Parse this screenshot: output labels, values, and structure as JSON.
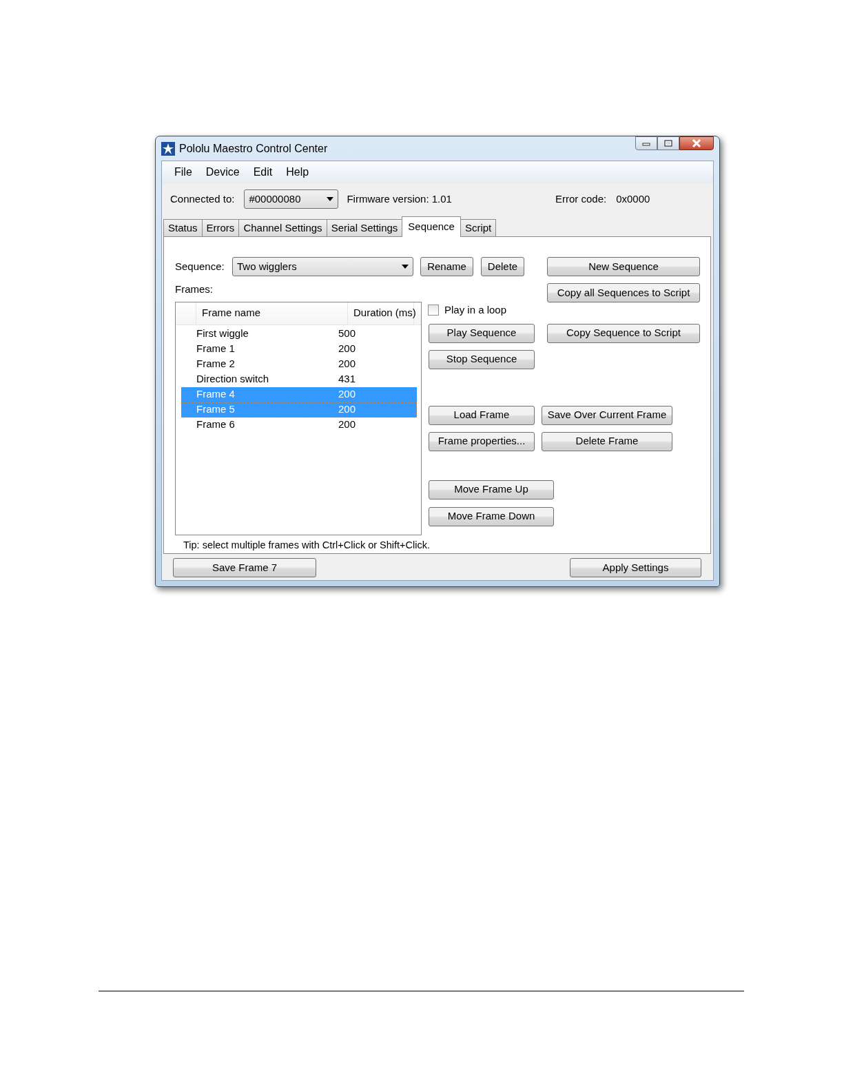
{
  "window": {
    "title": "Pololu Maestro Control Center"
  },
  "menu": [
    "File",
    "Device",
    "Edit",
    "Help"
  ],
  "connection": {
    "label": "Connected to:",
    "device": "#00000080",
    "firmware": "Firmware version: 1.01",
    "error_label": "Error code:",
    "error_value": "0x0000"
  },
  "tabs": [
    {
      "label": "Status",
      "selected": false
    },
    {
      "label": "Errors",
      "selected": false
    },
    {
      "label": "Channel Settings",
      "selected": false
    },
    {
      "label": "Serial Settings",
      "selected": false
    },
    {
      "label": "Sequence",
      "selected": true
    },
    {
      "label": "Script",
      "selected": false
    }
  ],
  "sequence": {
    "label": "Sequence:",
    "value": "Two wigglers"
  },
  "buttons": {
    "rename": "Rename",
    "delete": "Delete",
    "new_sequence": "New Sequence",
    "copy_all": "Copy all Sequences to Script",
    "play": "Play Sequence",
    "copy_sequence": "Copy Sequence to Script",
    "stop": "Stop Sequence",
    "load_frame": "Load Frame",
    "save_over": "Save Over Current Frame",
    "frame_properties": "Frame properties...",
    "delete_frame": "Delete Frame",
    "move_up": "Move Frame Up",
    "move_down": "Move Frame Down"
  },
  "play_in_loop": {
    "label": "Play in a loop",
    "checked": false
  },
  "frames": {
    "label": "Frames:",
    "columns": [
      "Frame name",
      "Duration (ms)"
    ],
    "rows": [
      {
        "name": "First wiggle",
        "duration": "500",
        "selected": false,
        "focused": false
      },
      {
        "name": "Frame 1",
        "duration": "200",
        "selected": false,
        "focused": false
      },
      {
        "name": "Frame 2",
        "duration": "200",
        "selected": false,
        "focused": false
      },
      {
        "name": "Direction switch",
        "duration": "431",
        "selected": false,
        "focused": false
      },
      {
        "name": "Frame 4",
        "duration": "200",
        "selected": true,
        "focused": false
      },
      {
        "name": "Frame 5",
        "duration": "200",
        "selected": true,
        "focused": true
      },
      {
        "name": "Frame 6",
        "duration": "200",
        "selected": false,
        "focused": false
      }
    ]
  },
  "tip": "Tip: select multiple frames with Ctrl+Click or Shift+Click.",
  "bottom_buttons": [
    "Save Frame 7",
    "Apply Settings"
  ]
}
